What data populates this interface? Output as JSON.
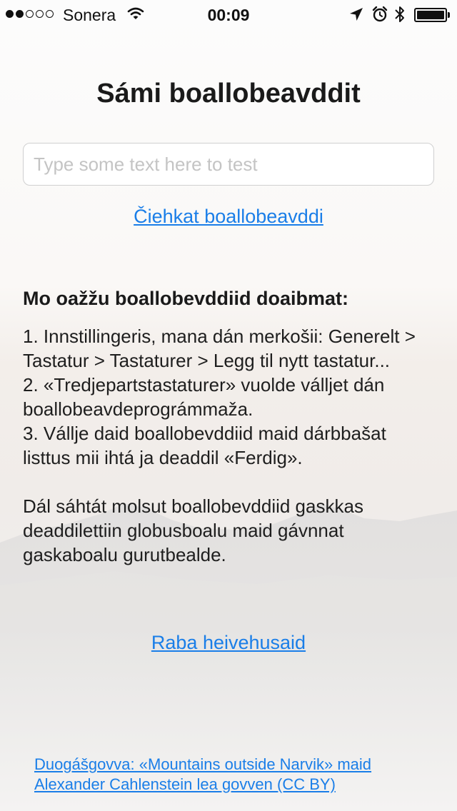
{
  "status_bar": {
    "carrier": "Sonera",
    "time": "00:09",
    "signal_dots": [
      true,
      true,
      false,
      false,
      false
    ],
    "icons": [
      "wifi-icon",
      "location-arrow-icon",
      "alarm-clock-icon",
      "bluetooth-icon",
      "battery-icon"
    ],
    "battery_level": 1.0
  },
  "page": {
    "title": "Sámi boallobeavddit",
    "test_input": {
      "value": "",
      "placeholder": "Type some text here to test"
    },
    "test_link": "Čiehkat boallobeavddi",
    "instructions": {
      "heading": "Mo oažžu boallobevddiid doaibmat:",
      "step1": "1. Innstillingeris, mana dán merkošii: Generelt > Tastatur > Tastaturer > Legg til nytt tastatur...",
      "step2": "2. «Tredjepartstastaturer» vuolde válljet dán boallobeavdeprográmmaža.",
      "step3": "3. Vállje daid boallobevddiid maid dárbbašat listtus mii ihtá ja deaddil «Ferdig».",
      "note": "Dál sáhtát molsut boallobevddiid gaskkas deaddilettiin globusboalu maid gávnnat gaskaboalu gurutbealde."
    },
    "settings_link": "Raba heivehusaid",
    "credit_link": "Duogášgovva: «Mountains outside Narvik» maid Alexander Cahlenstein lea govven (CC BY)"
  },
  "colors": {
    "link": "#1a7ee8",
    "text": "#1b1b1b",
    "background": "#f6f5f4"
  }
}
